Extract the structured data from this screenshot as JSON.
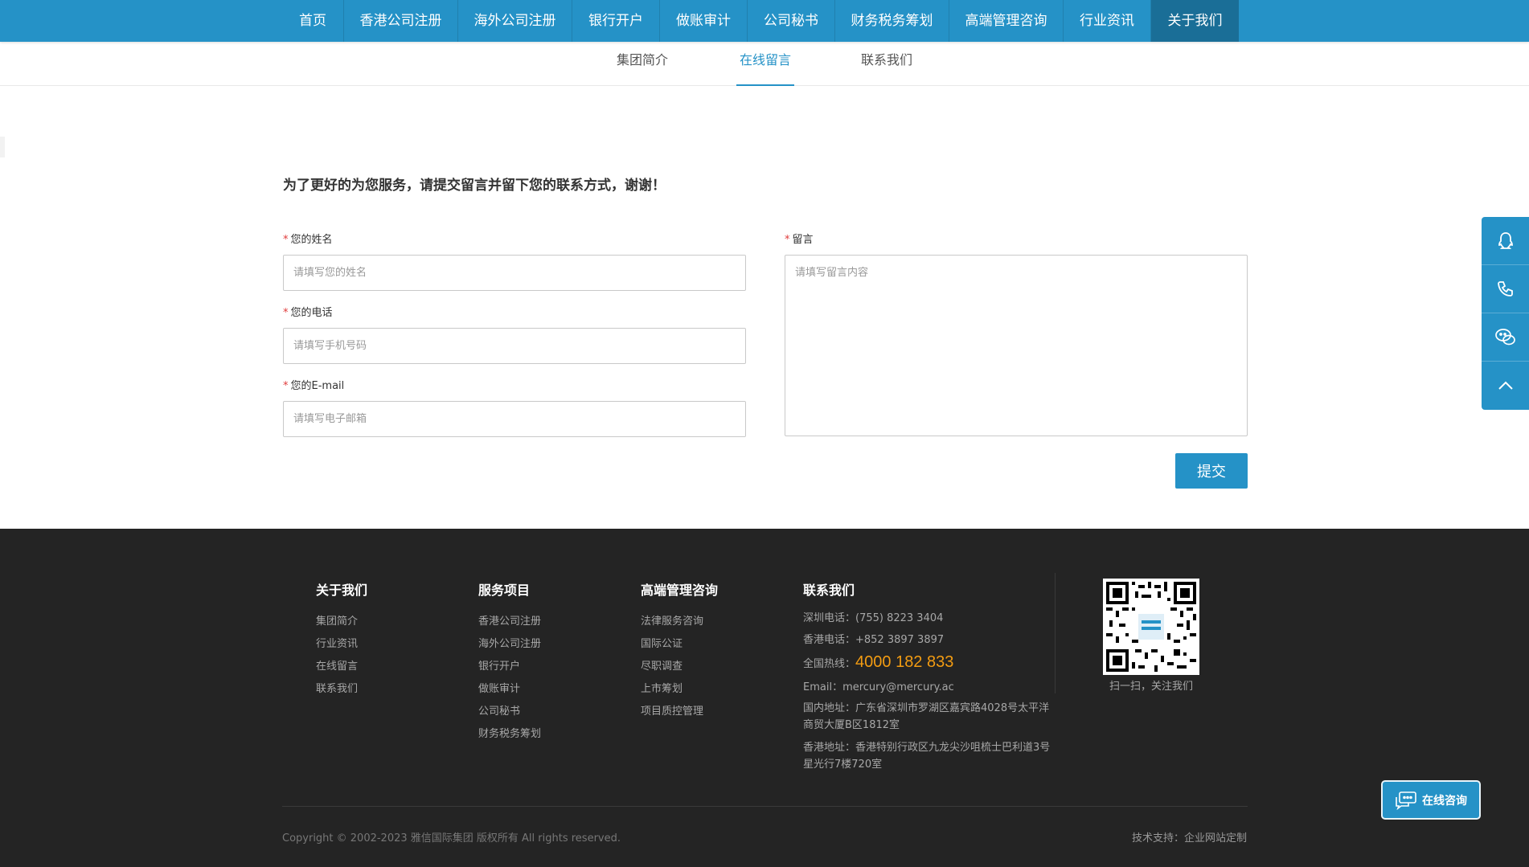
{
  "nav": {
    "items": [
      {
        "label": "首页",
        "width": 77
      },
      {
        "label": "香港公司注册",
        "width": 142
      },
      {
        "label": "海外公司注册",
        "width": 142
      },
      {
        "label": "银行开户",
        "width": 109
      },
      {
        "label": "做账审计",
        "width": 109
      },
      {
        "label": "公司秘书",
        "width": 109
      },
      {
        "label": "财务税务筹划",
        "width": 142
      },
      {
        "label": "高端管理咨询",
        "width": 142
      },
      {
        "label": "行业资讯",
        "width": 109
      },
      {
        "label": "关于我们",
        "width": 109
      }
    ]
  },
  "subnav": {
    "items": [
      "集团简介",
      "在线留言",
      "联系我们"
    ]
  },
  "form": {
    "intro": "为了更好的为您服务，请提交留言并留下您的联系方式，谢谢！",
    "required_mark": "*",
    "name_label": "您的姓名",
    "name_placeholder": "请填写您的姓名",
    "phone_label": "您的电话",
    "phone_placeholder": "请填写手机号码",
    "email_label": "您的E-mail",
    "email_placeholder": "请填写电子邮箱",
    "message_label": "留言",
    "message_placeholder": "请填写留言内容",
    "submit_label": "提交"
  },
  "side_float": {
    "icons": [
      "qq-icon",
      "phone-icon",
      "wechat-icon",
      "back-to-top-icon"
    ]
  },
  "footer": {
    "about": {
      "title": "关于我们",
      "links": [
        "集团简介",
        "行业资讯",
        "在线留言",
        "联系我们"
      ]
    },
    "services": {
      "title": "服务项目",
      "links": [
        "香港公司注册",
        "海外公司注册",
        "银行开户",
        "做账审计",
        "公司秘书",
        "财务税务筹划"
      ]
    },
    "consulting": {
      "title": "高端管理咨询",
      "links": [
        "法律服务咨询",
        "国际公证",
        "尽职调查",
        "上市筹划",
        "项目质控管理"
      ]
    },
    "contact": {
      "title": "联系我们",
      "shenzhen_phone": "深圳电话：(755) 8223 3404",
      "hk_phone": "香港电话：+852 3897 3897",
      "hotline_label": "全国热线：",
      "hotline_number": "4000 182 833",
      "email": "Email：mercury@mercury.ac",
      "domestic_address": "国内地址：广东省深圳市罗湖区嘉宾路4028号太平洋商贸大厦B区1812室",
      "hk_address": "香港地址：香港特别行政区九龙尖沙咀梳士巴利道3号星光行7楼720室"
    },
    "qr_caption": "扫一扫，关注我们",
    "copyright": "Copyright © 2002-2023 雅信国际集团 版权所有 All rights reserved.",
    "tech_label": "技术支持：",
    "tech_value": "企业网站定制"
  },
  "consult_button": {
    "label": "在线咨询"
  },
  "colors": {
    "accent": "#2592c7",
    "nav_active": "#1a6e97",
    "footer_bg": "#242424",
    "hotline": "#f39c12"
  }
}
